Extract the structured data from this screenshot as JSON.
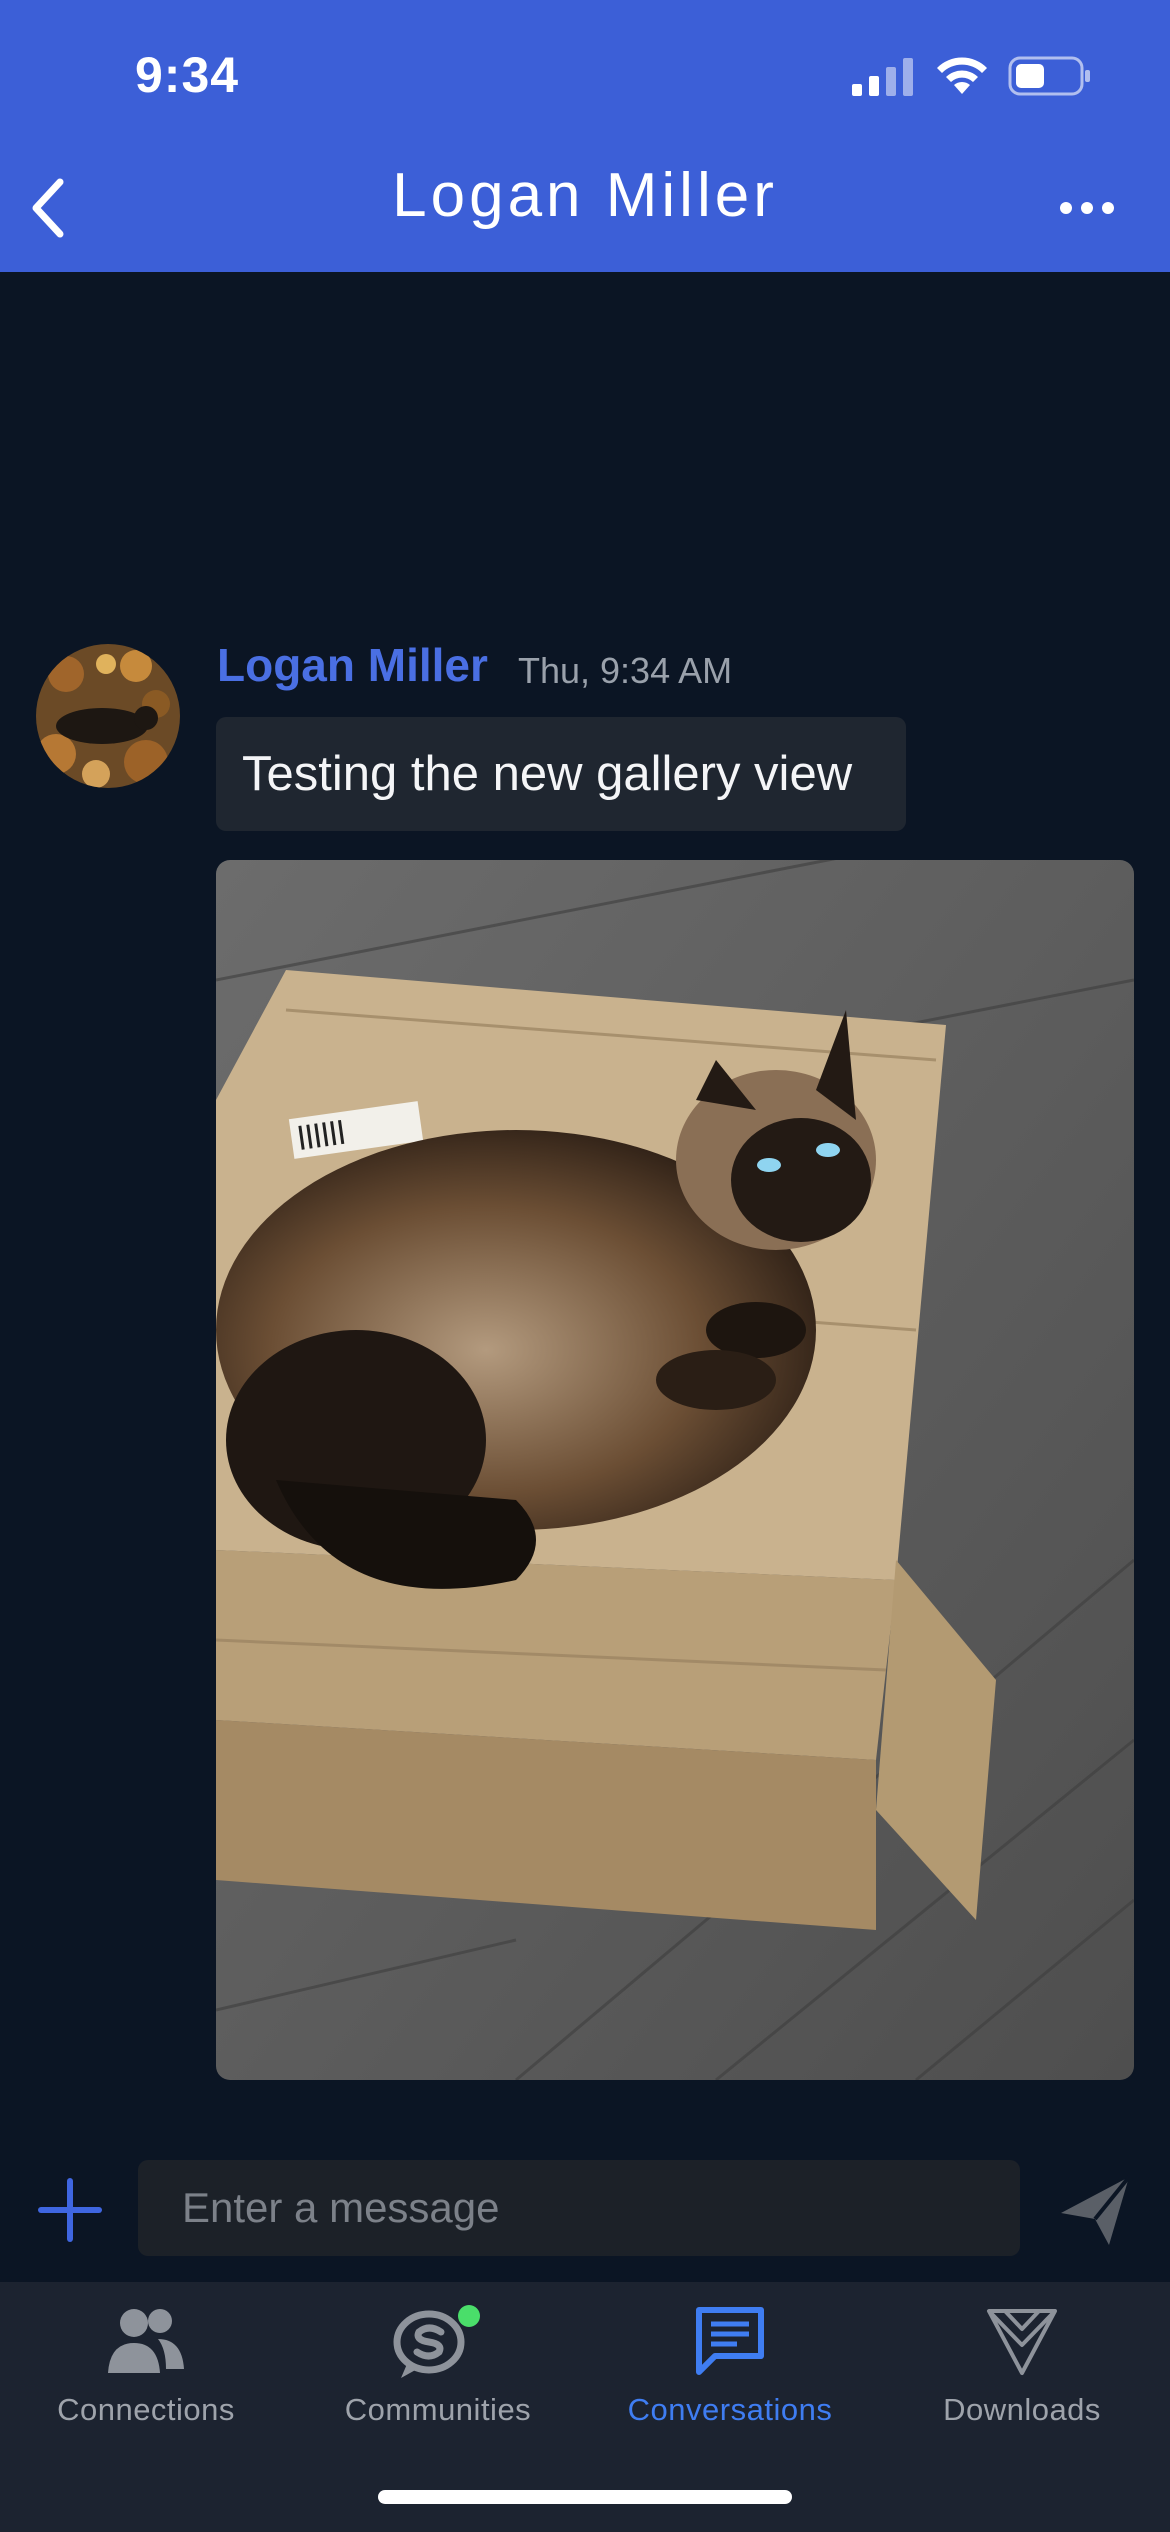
{
  "status_bar": {
    "time": "9:34"
  },
  "nav": {
    "title": "Logan Miller"
  },
  "message": {
    "sender": "Logan Miller",
    "timestamp": "Thu, 9:34 AM",
    "text": "Testing the new gallery view",
    "attachment_icon": "photo-icon"
  },
  "composer": {
    "placeholder": "Enter a message"
  },
  "tabs": [
    {
      "label": "Connections",
      "icon": "people-icon"
    },
    {
      "label": "Communities",
      "icon": "communities-icon"
    },
    {
      "label": "Conversations",
      "icon": "chat-icon"
    },
    {
      "label": "Downloads",
      "icon": "downloads-icon"
    }
  ],
  "colors": {
    "header": "#3c5fd7",
    "background": "#0b1524",
    "accent": "#3f7df2",
    "online": "#4ade6a"
  }
}
